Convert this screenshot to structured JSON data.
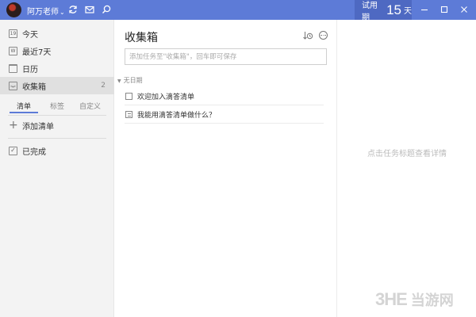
{
  "titlebar": {
    "username": "阿万老师",
    "caret": "⌄",
    "trial_label": "试用期",
    "trial_days": "15",
    "trial_unit": "天"
  },
  "sidebar": {
    "items": [
      {
        "label": "今天",
        "icon": "today-icon",
        "icon_glyph": "19",
        "count": ""
      },
      {
        "label": "最近7天",
        "icon": "week-icon",
        "icon_glyph": "W",
        "count": ""
      },
      {
        "label": "日历",
        "icon": "calendar-icon",
        "icon_glyph": "",
        "count": ""
      },
      {
        "label": "收集箱",
        "icon": "inbox-icon",
        "icon_glyph": "",
        "count": "2"
      }
    ],
    "tabs": [
      {
        "label": "清单"
      },
      {
        "label": "标签"
      },
      {
        "label": "自定义"
      }
    ],
    "add_list_label": "添加清单",
    "completed_label": "已完成"
  },
  "main": {
    "title": "收集箱",
    "add_placeholder": "添加任务至\"收集箱\"，回车即可保存",
    "section_caret": "▼",
    "section_label": "无日期",
    "tasks": [
      {
        "title": "欢迎加入滴答清单",
        "icon": "checkbox-icon"
      },
      {
        "title": "我能用滴答清单做什么？",
        "icon": "note-icon"
      }
    ]
  },
  "detail": {
    "hint": "点击任务标题查看详情"
  },
  "watermark": {
    "logo": "3HE",
    "text": "当游网"
  },
  "colors": {
    "accent": "#5d7bd7",
    "trial_bg": "#4e69c2",
    "sidebar_bg": "#f3f3f3",
    "active_item_bg": "#e0e0e0"
  }
}
